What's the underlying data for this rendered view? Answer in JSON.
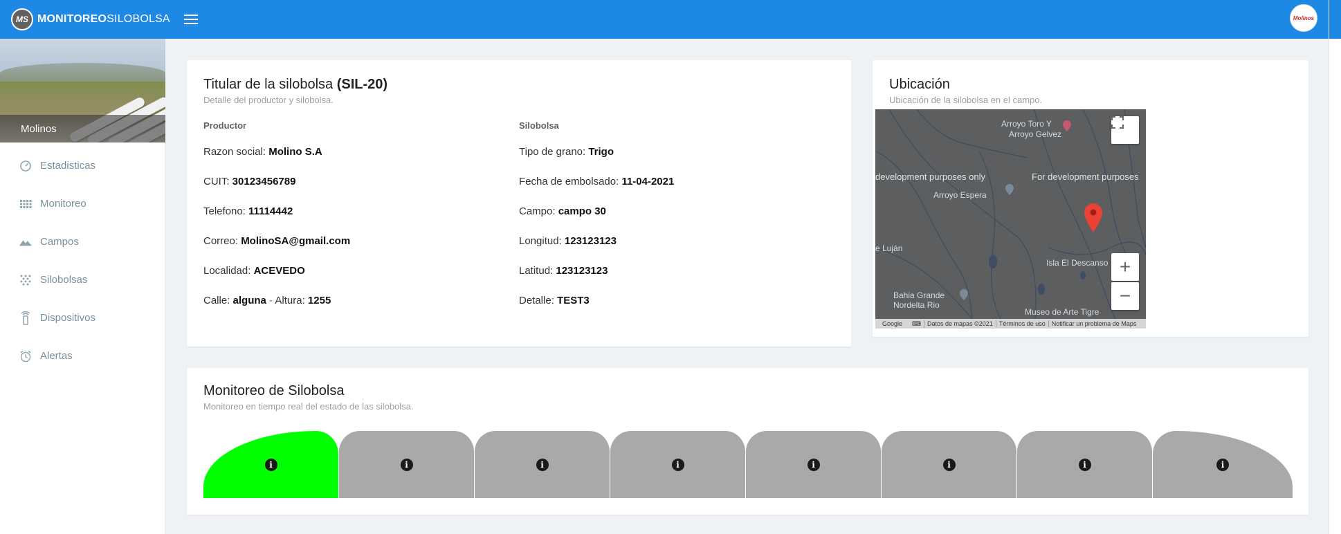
{
  "header": {
    "logo_mark": "MS",
    "brand_bold": "MONITOREO",
    "brand_light": "SILOBOLSA",
    "avatar_text": "Molinos"
  },
  "sidebar": {
    "banner_name": "Molinos",
    "items": [
      {
        "label": "Estadisticas",
        "icon": "speedometer-icon"
      },
      {
        "label": "Monitoreo",
        "icon": "grid-icon"
      },
      {
        "label": "Campos",
        "icon": "mountains-icon"
      },
      {
        "label": "Silobolsas",
        "icon": "dots-icon"
      },
      {
        "label": "Dispositivos",
        "icon": "remote-icon"
      },
      {
        "label": "Alertas",
        "icon": "alarm-clock-icon"
      }
    ]
  },
  "titular": {
    "title_prefix": "Titular de la silobolsa ",
    "title_code": "(SIL-20)",
    "subtitle": "Detalle del productor y silobolsa.",
    "productor_heading": "Productor",
    "silobolsa_heading": "Silobolsa",
    "productor": [
      {
        "label": "Razon social: ",
        "value": "Molino S.A"
      },
      {
        "label": "CUIT: ",
        "value": "30123456789"
      },
      {
        "label": "Telefono: ",
        "value": "11114442"
      },
      {
        "label": "Correo: ",
        "value": "MolinoSA@gmail.com"
      },
      {
        "label": "Localidad: ",
        "value": "ACEVEDO"
      }
    ],
    "calle_label": "Calle: ",
    "calle_value": "alguna",
    "calle_sep": " - ",
    "altura_label": "Altura: ",
    "altura_value": "1255",
    "silobolsa": [
      {
        "label": "Tipo de grano: ",
        "value": "Trigo"
      },
      {
        "label": "Fecha de embolsado: ",
        "value": "11-04-2021"
      },
      {
        "label": "Campo: ",
        "value": "campo 30"
      },
      {
        "label": "Longitud: ",
        "value": "123123123"
      },
      {
        "label": "Latitud: ",
        "value": "123123123"
      },
      {
        "label": "Detalle: ",
        "value": "TEST3"
      }
    ]
  },
  "ubicacion": {
    "title": "Ubicación",
    "subtitle": "Ubicación de la silobolsa en el campo.",
    "map": {
      "dev_left": "development purposes only",
      "dev_right": "For development purposes",
      "places": {
        "toro": "Arroyo Toro Y",
        "gelvez": "Arroyo Gelvez",
        "espera": "Arroyo Espera",
        "lujan": "e Luján",
        "descanso": "Isla El Descanso",
        "bahia": "Bahia Grande",
        "nordelta": "Nordelta Rio",
        "tigre": "Museo de Arte Tigre"
      },
      "google": "Google",
      "footer": [
        "Datos de mapas ©2021",
        "Términos de uso",
        "Notificar un problema de Maps"
      ],
      "zoom_in": "+",
      "zoom_out": "−"
    }
  },
  "monitoreo": {
    "title": "Monitoreo de Silobolsa",
    "subtitle": "Monitoreo en tiempo real del estado de las silobolsa.",
    "info_glyph": "i",
    "segments": [
      {
        "status": "ok",
        "color": "#00ff00"
      },
      {
        "status": "inactive",
        "color": "#a9a9a9"
      },
      {
        "status": "inactive",
        "color": "#a9a9a9"
      },
      {
        "status": "inactive",
        "color": "#a9a9a9"
      },
      {
        "status": "inactive",
        "color": "#a9a9a9"
      },
      {
        "status": "inactive",
        "color": "#a9a9a9"
      },
      {
        "status": "inactive",
        "color": "#a9a9a9"
      },
      {
        "status": "inactive",
        "color": "#a9a9a9"
      }
    ]
  },
  "colors": {
    "topbar": "#1e88e5",
    "segment_ok": "#00ff00",
    "segment_inactive": "#a9a9a9"
  }
}
